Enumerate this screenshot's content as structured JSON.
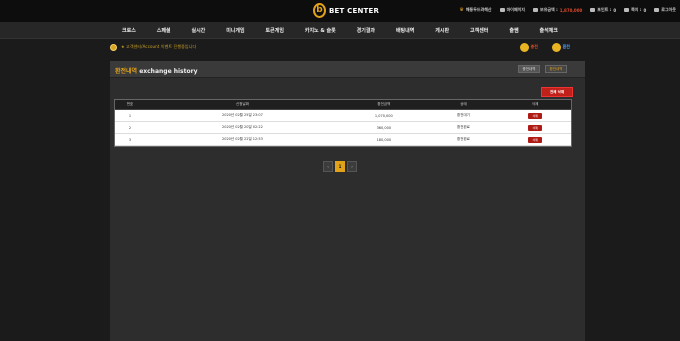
{
  "brand": {
    "name": "BET CENTER",
    "mark": "b"
  },
  "user": [
    {
      "icon": "crown-icon",
      "label": "해동두드려해산"
    },
    {
      "icon": "card-icon",
      "label": "마이페이지"
    },
    {
      "icon": "wallet-icon",
      "label": "보유금액 : ",
      "value": "1,870,000"
    },
    {
      "icon": "coin-icon",
      "label": "포인트 : ",
      "value": "0"
    },
    {
      "icon": "mail-icon",
      "label": "쪽지 : ",
      "value": "0"
    },
    {
      "icon": "logout-icon",
      "label": "로그아웃"
    }
  ],
  "nav": [
    "크로스",
    "스페셜",
    "실시간",
    "미니게임",
    "토큰게임",
    "카지노 & 슬롯",
    "경기결과",
    "배팅내역",
    "게시판",
    "고객센터",
    "출쌤",
    "출석체크"
  ],
  "notice": "★ 고객센터/Account 이벤트 진행중입니다",
  "actions": {
    "deposit": "충전",
    "withdraw": "환전"
  },
  "page": {
    "title_ko": "환전내역",
    "title_en": "exchange history",
    "tab1": "충전내역",
    "tab2": "환전내역",
    "delete_all": "전체 삭제"
  },
  "table": {
    "headers": [
      "번호",
      "신청날짜",
      "환전금액",
      "상태",
      "삭제"
    ],
    "rows": [
      {
        "no": "1",
        "date": "2020년 02월 25일 23:07",
        "amount": "1,070,000",
        "status": "환전대기",
        "action": "삭제"
      },
      {
        "no": "2",
        "date": "2020년 02월 20일 02:22",
        "amount": "360,000",
        "status": "환전완료",
        "action": "삭제"
      },
      {
        "no": "3",
        "date": "2020년 02월 22일 12:53",
        "amount": "180,000",
        "status": "환전완료",
        "action": "삭제"
      }
    ]
  },
  "pager": {
    "prev": "‹",
    "current": "1",
    "next": "›"
  },
  "colors": {
    "accent": "#e1a21a",
    "danger": "#c0201a",
    "bg": "#1b1b1b"
  }
}
